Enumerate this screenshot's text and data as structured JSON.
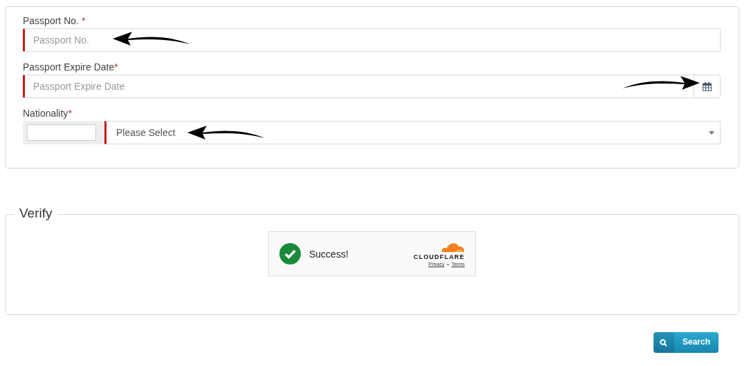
{
  "form": {
    "fields": [
      {
        "kind": "text",
        "label": "Passport No.",
        "required_mark": "*",
        "mark_spaced": true,
        "placeholder": "Passport No.",
        "arrow_points_right": false
      },
      {
        "kind": "date",
        "label": "Passport Expire Date",
        "required_mark": "*",
        "mark_spaced": false,
        "placeholder": "Passport Expire Date",
        "arrow_points_right": true
      },
      {
        "kind": "select",
        "label": "Nationality",
        "required_mark": "*",
        "mark_spaced": false,
        "value": "Please Select",
        "arrow_points_right": false
      }
    ]
  },
  "verify": {
    "legend": "Verify",
    "captcha": {
      "status": "Success!",
      "brand": "CLOUDFLARE",
      "links": [
        "Privacy",
        "Terms"
      ],
      "separator": "•"
    }
  },
  "search_button": {
    "label": "Search"
  }
}
